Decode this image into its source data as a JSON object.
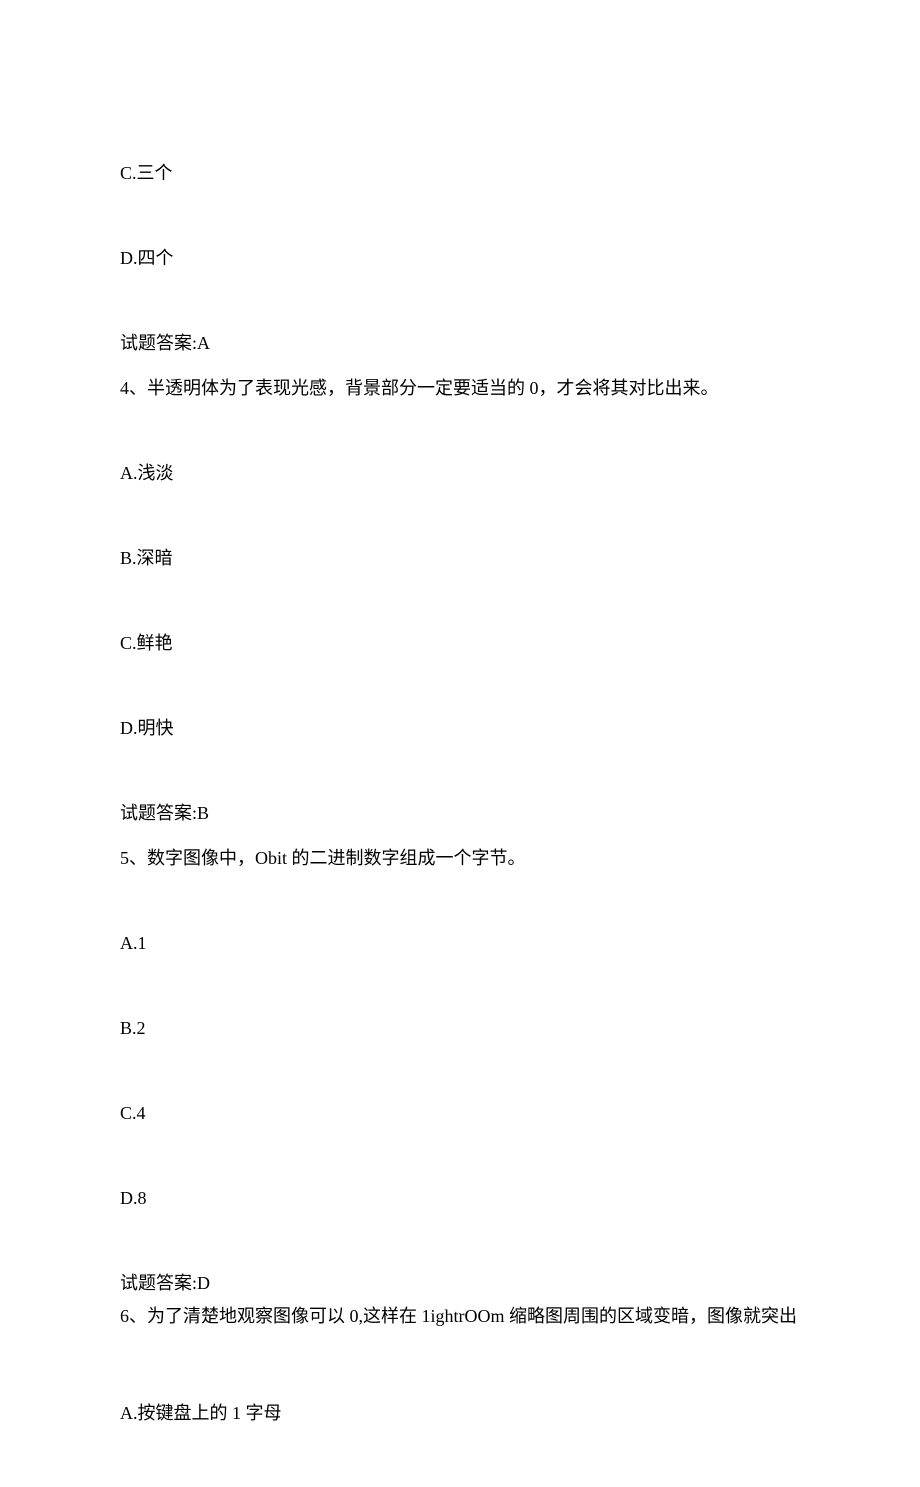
{
  "partial_options_top": {
    "c": "C.三个",
    "d": "D.四个"
  },
  "answer_top": "试题答案:A",
  "q4": {
    "text": "4、半透明体为了表现光感，背景部分一定要适当的 0，才会将其对比出来。",
    "a": "A.浅淡",
    "b": "B.深暗",
    "c": "C.鲜艳",
    "d": "D.明快",
    "answer": "试题答案:B"
  },
  "q5": {
    "text": "5、数字图像中，Obit 的二进制数字组成一个字节。",
    "a": "A.1",
    "b": "B.2",
    "c": "C.4",
    "d": "D.8",
    "answer": "试题答案:D"
  },
  "q6": {
    "text": "6、为了清楚地观察图像可以 0,这样在 1ightrOOm 缩略图周围的区域变暗，图像就突出",
    "a": "A.按键盘上的 1 字母"
  }
}
